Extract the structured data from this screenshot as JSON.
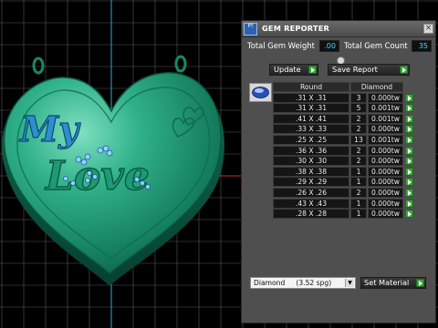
{
  "viewport": {
    "engraving_line1": "My",
    "engraving_line2": "Love"
  },
  "panel": {
    "title": "GEM REPORTER",
    "app_icon_text": "PT",
    "close_glyph": "×",
    "total_weight_label": "Total Gem Weight",
    "total_weight_value": ".00",
    "total_count_label": "Total Gem Count",
    "total_count_value": "35",
    "update_label": "Update",
    "save_report_label": "Save Report",
    "table": {
      "headers": [
        "Round",
        "Diamond"
      ],
      "rows": [
        {
          "size": ".31 X .31",
          "count": "3",
          "weight": "0.000tw"
        },
        {
          "size": ".31 X .31",
          "count": "5",
          "weight": "0.001tw"
        },
        {
          "size": ".41 X .41",
          "count": "2",
          "weight": "0.001tw"
        },
        {
          "size": ".33 X .33",
          "count": "2",
          "weight": "0.000tw"
        },
        {
          "size": ".25 X .25",
          "count": "13",
          "weight": "0.001tw"
        },
        {
          "size": ".36 X .36",
          "count": "2",
          "weight": "0.000tw"
        },
        {
          "size": ".30 X .30",
          "count": "2",
          "weight": "0.000tw"
        },
        {
          "size": ".38 X .38",
          "count": "1",
          "weight": "0.000tw"
        },
        {
          "size": ".29 X .29",
          "count": "1",
          "weight": "0.000tw"
        },
        {
          "size": ".26 X .26",
          "count": "2",
          "weight": "0.000tw"
        },
        {
          "size": ".43 X .43",
          "count": "1",
          "weight": "0.000tw"
        },
        {
          "size": ".28 X .28",
          "count": "1",
          "weight": "0.000tw"
        }
      ]
    },
    "material_value": "Diamond     (3.52 spg)",
    "set_material_label": "Set Material"
  },
  "colors": {
    "background": "#000000",
    "grid": "#5a5a5a",
    "heart": "#1f9a72",
    "accent_green": "#3da53d",
    "value_cyan": "#4dd8ff"
  }
}
